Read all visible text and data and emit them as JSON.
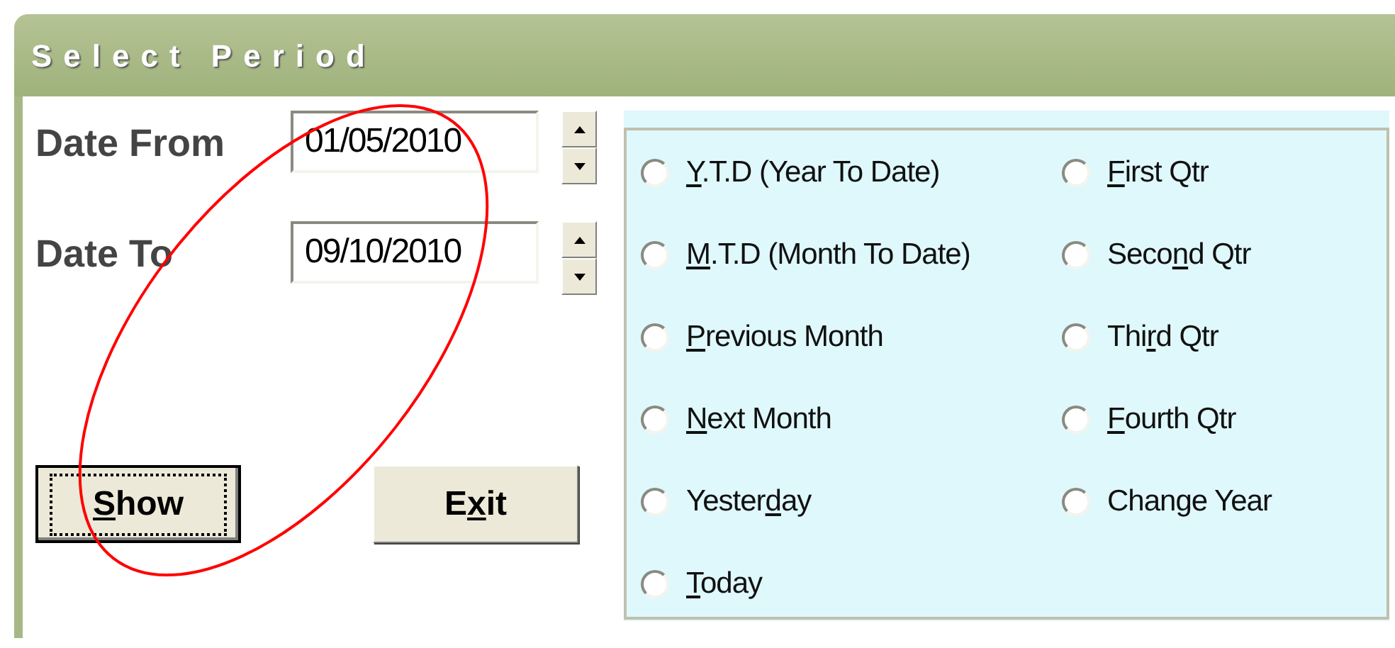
{
  "window": {
    "title": "Select Period"
  },
  "dates": [
    {
      "label": "Date From",
      "value": "01/05/2010"
    },
    {
      "label": "Date To",
      "value": "09/10/2010"
    }
  ],
  "buttons": [
    {
      "key": "S",
      "after": "how",
      "default": true
    },
    {
      "before": "E",
      "key": "x",
      "after": "it",
      "default": false
    }
  ],
  "periods": {
    "columns": [
      [
        {
          "key": "Y",
          "after": ".T.D (Year To Date)",
          "selected": false
        },
        {
          "key": "M",
          "after": ".T.D (Month To Date)",
          "selected": false
        },
        {
          "key": "P",
          "after": "revious Month",
          "selected": false
        },
        {
          "key": "N",
          "after": "ext Month",
          "selected": false
        },
        {
          "before": "Yester",
          "key": "d",
          "after": "ay",
          "selected": false
        },
        {
          "key": "T",
          "after": "oday",
          "selected": false
        }
      ],
      [
        {
          "key": "F",
          "after": "irst Qtr",
          "selected": false
        },
        {
          "before": "Seco",
          "key": "n",
          "after": "d Qtr",
          "selected": false
        },
        {
          "before": "Thi",
          "key": "r",
          "after": "d Qtr",
          "selected": false
        },
        {
          "key": "F",
          "after": "ourth Qtr",
          "selected": false
        },
        {
          "before": "Change Year",
          "selected": false
        }
      ]
    ]
  },
  "annotation": {
    "kind": "ellipse",
    "color": "#ff0000"
  }
}
